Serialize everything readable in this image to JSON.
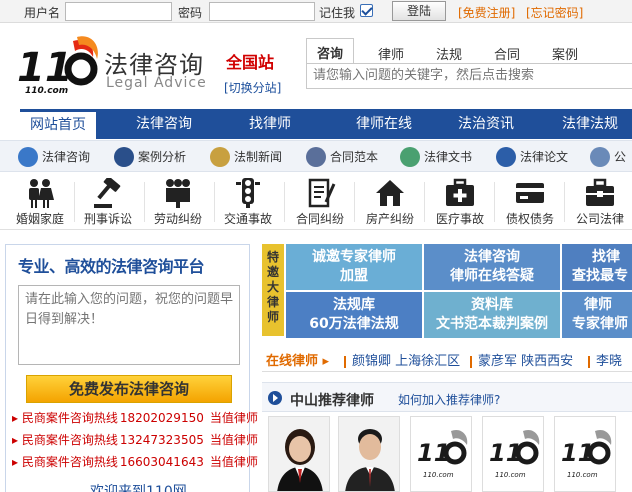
{
  "login": {
    "username_label": "用户名",
    "password_label": "密码",
    "remember_label": "记住我",
    "submit_label": "登陆",
    "register_link": "[免费注册]",
    "forgot_link": "[忘记密码]"
  },
  "header": {
    "logo_cn": "法律咨询",
    "logo_en": "Legal Advice",
    "station": "全国站",
    "switch_station": "[切换分站]"
  },
  "search": {
    "tabs": [
      {
        "label": "咨询"
      },
      {
        "label": "律师"
      },
      {
        "label": "法规"
      },
      {
        "label": "合同"
      },
      {
        "label": "案例"
      }
    ],
    "placeholder": "请您输入问题的关键字，然后点击搜索"
  },
  "mainnav": {
    "items": [
      {
        "label": "网站首页"
      },
      {
        "label": "法律咨询"
      },
      {
        "label": "找律师"
      },
      {
        "label": "律师在线"
      },
      {
        "label": "法治资讯"
      },
      {
        "label": "法律法规"
      }
    ]
  },
  "subnav": {
    "items": [
      {
        "label": "法律咨询",
        "color": "#3a78c8"
      },
      {
        "label": "案例分析",
        "color": "#2a4f8a"
      },
      {
        "label": "法制新闻",
        "color": "#c8a040"
      },
      {
        "label": "合同范本",
        "color": "#5a6f9a"
      },
      {
        "label": "法律文书",
        "color": "#4aa070"
      },
      {
        "label": "法律论文",
        "color": "#2c5ea8"
      },
      {
        "label": "公",
        "color": "#6a8ab8"
      }
    ]
  },
  "categories": {
    "items": [
      {
        "label": "婚姻家庭",
        "icon": "family-icon"
      },
      {
        "label": "刑事诉讼",
        "icon": "gavel-icon"
      },
      {
        "label": "劳动纠纷",
        "icon": "workers-icon"
      },
      {
        "label": "交通事故",
        "icon": "traffic-light-icon"
      },
      {
        "label": "合同纠纷",
        "icon": "contract-icon"
      },
      {
        "label": "房产纠纷",
        "icon": "house-icon"
      },
      {
        "label": "医疗事故",
        "icon": "medical-kit-icon"
      },
      {
        "label": "债权债务",
        "icon": "credit-card-icon"
      },
      {
        "label": "公司法律",
        "icon": "briefcase-icon"
      }
    ]
  },
  "consult": {
    "title": "专业、高效的法律咨询平台",
    "textarea_placeholder": "请在此输入您的问题，祝您的问题早日得到解决！",
    "submit_label": "免费发布法律咨询",
    "hotlines": [
      {
        "label": "民商案件咨询热线",
        "number": "18202029150",
        "tag": "当值律师"
      },
      {
        "label": "民商案件咨询热线",
        "number": "13247323505",
        "tag": "当值律师"
      },
      {
        "label": "民商案件咨询热线",
        "number": "16603041643",
        "tag": "当值律师"
      }
    ],
    "welcome": "欢迎来到110网"
  },
  "feature": {
    "side_label": "特邀大律师",
    "tiles": [
      {
        "line1": "诚邀专家律师",
        "line2": "加盟",
        "color": "#6aaed6"
      },
      {
        "line1": "法律咨询",
        "line2": "律师在线答疑",
        "color": "#5b8ec9"
      },
      {
        "line1": "找律",
        "line2": "查找最专",
        "color": "#4f7fc0"
      },
      {
        "line1": "法规库",
        "line2": "60万法律法规",
        "color": "#4c7fc4"
      },
      {
        "line1": "资料库",
        "line2": "文书范本裁判案例",
        "color": "#6fb0cf"
      },
      {
        "line1": "律师",
        "line2": "专家律师",
        "color": "#5b8ec9"
      }
    ]
  },
  "online_lawyers": {
    "title": "在线律师",
    "items": [
      {
        "label": "颜锦卿 上海徐汇区"
      },
      {
        "label": "蒙彦军 陕西西安"
      },
      {
        "label": "李晓"
      }
    ]
  },
  "recommend": {
    "title": "中山推荐律师",
    "link": "如何加入推荐律师?"
  }
}
